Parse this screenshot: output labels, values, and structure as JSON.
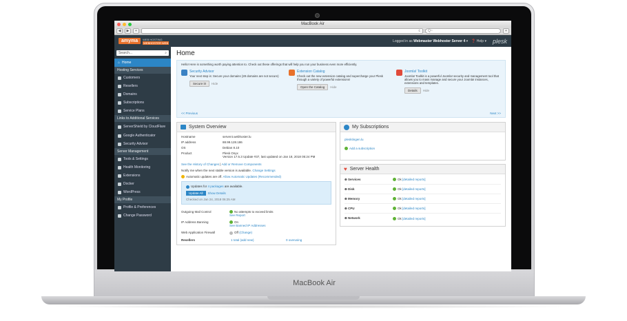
{
  "device": {
    "label": "MacBook Air"
  },
  "browser": {
    "title": "MacBook Air",
    "nav_back": "◀",
    "nav_fwd": "▶",
    "new_tab": "+",
    "reload": "c",
    "add": "+",
    "search_placeholder": "Q~"
  },
  "header": {
    "logo": "amyma",
    "logo_sub1": "WEB HOSTING",
    "logo_sub2": "WEBHOSTER WEB",
    "logged_in_label": "Logged in as",
    "user": "Webmaster Webhoster Server 4",
    "help": "Help",
    "brand": "plesk"
  },
  "sidebar": {
    "search_placeholder": "Search...",
    "home": "Home",
    "sections": [
      {
        "title": "Hosting Services",
        "items": [
          "Customers",
          "Resellers",
          "Domains",
          "Subscriptions",
          "Service Plans"
        ]
      },
      {
        "title": "Links to Additional Services",
        "items": [
          "ServerShield by CloudFlare",
          "Google Authenticator",
          "Security Advisor"
        ]
      },
      {
        "title": "Server Management",
        "items": [
          "Tools & Settings",
          "Health Monitoring",
          "Extensions",
          "Docker",
          "WordPress"
        ]
      },
      {
        "title": "My Profile",
        "items": [
          "Profile & Preferences",
          "Change Password"
        ]
      }
    ]
  },
  "main": {
    "title": "Home",
    "promo": {
      "message": "Hello! Here is something worth paying attention to. Check out these offerings that will help you run your business even more efficiently.",
      "items": [
        {
          "title": "Security Advisor",
          "text": "Your next step is: Secure your domains (28 domains are not secure)",
          "button": "Secure it!",
          "hide": "Hide",
          "color": "#3a82c4"
        },
        {
          "title": "Extension Catalog",
          "text": "Check out the new extension catalog and supercharge your Plesk through a variety of powerful extensions!",
          "button": "Open the Catalog",
          "hide": "Hide",
          "color": "#e8712b"
        },
        {
          "title": "Joomla! Toolkit",
          "text": "Joomla! Toolkit is a powerful Joomla! security and management tool that allows you to mass manage and secure your Joomla! instances, extensions and templates.",
          "button": "Details",
          "hide": "Hide",
          "color": "#e04a3a"
        }
      ],
      "prev": "<< Previous",
      "next": "Next >>"
    },
    "system": {
      "title": "System Overview",
      "rows": [
        {
          "k": "Hostname",
          "v": "server4.webhoster.lu"
        },
        {
          "k": "IP address",
          "v": "88.99.128.186"
        },
        {
          "k": "OS",
          "v": "Debian 8.10"
        },
        {
          "k": "Product",
          "v": "Plesk Onyx\nVersion 17.5.3 Update #37, last updated on Jan 18, 2018 05:24 PM"
        }
      ],
      "history_link": "See the History of Changes",
      "components_link": "Add or Remove Components",
      "notify_text": "Notify me when the next stable version is available.",
      "change_settings": "Change Settings",
      "auto_text": "Automatic updates are off.",
      "auto_link": "Allow Automatic Updates (Recommended)",
      "updates_pre": "Updates for",
      "updates_link": "4 packages",
      "updates_post": "are available.",
      "update_all": "Update All",
      "show_details": "Show Details",
      "checked": "Checked on Jan 24, 2018 06:25 AM",
      "mail_label": "Outgoing Mail Control",
      "mail_status": "No attempts to exceed limits",
      "mail_link": "See Report",
      "ban_label": "IP Address Banning",
      "ban_status": "On",
      "ban_link": "See Banned IP Addresses",
      "waf_label": "Web Application Firewall",
      "waf_status": "Off",
      "waf_link": "(Change)",
      "resellers_label": "Resellers",
      "resellers_total": "1 total",
      "resellers_add": "(add new)",
      "resellers_over": "0 overusing"
    },
    "subs": {
      "title": "My Subscriptions",
      "link": "plesktingen.lu",
      "add": "Add a subscription"
    },
    "health": {
      "title": "Server Health",
      "rows": [
        {
          "k": "Services",
          "status": "Ok",
          "link": "[detailed reports]"
        },
        {
          "k": "Disk",
          "status": "Ok",
          "link": "[detailed reports]"
        },
        {
          "k": "Memory",
          "status": "Ok",
          "link": "[detailed reports]"
        },
        {
          "k": "CPU",
          "status": "Ok",
          "link": "[detailed reports]"
        },
        {
          "k": "Network",
          "status": "Ok",
          "link": "[detailed reports]"
        }
      ]
    }
  }
}
